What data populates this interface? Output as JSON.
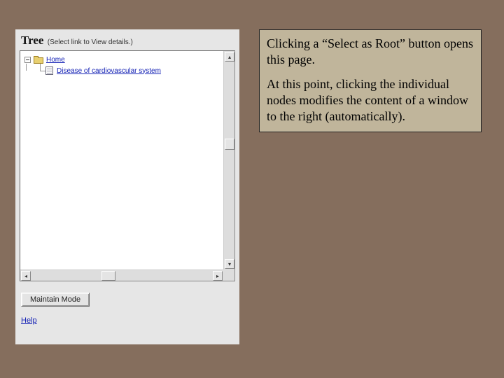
{
  "panel": {
    "title": "Tree",
    "subtitle": "(Select link to View details.)",
    "tree": {
      "root": {
        "label": "Home"
      },
      "child": {
        "label": "Disease of cardiovascular system"
      }
    },
    "maintain_button": "Maintain Mode",
    "help_link": "Help"
  },
  "note": {
    "p1": "Clicking a “Select as Root” button opens this page.",
    "p2": "At this point, clicking the individual nodes modifies the content of a window to the right (automatically)."
  }
}
